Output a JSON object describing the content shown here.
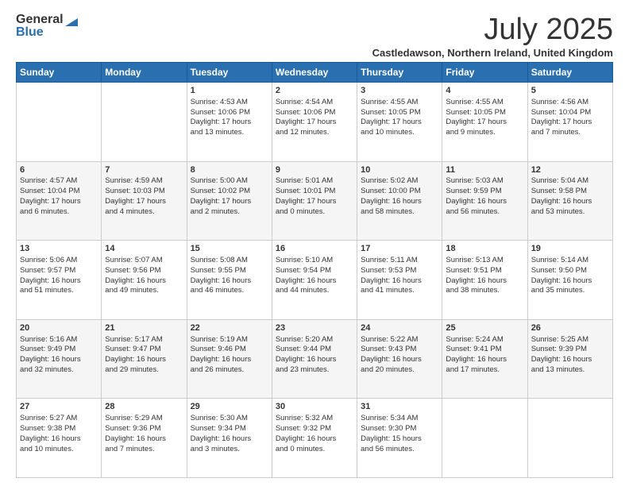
{
  "logo": {
    "general": "General",
    "blue": "Blue"
  },
  "header": {
    "title": "July 2025",
    "subtitle": "Castledawson, Northern Ireland, United Kingdom"
  },
  "weekdays": [
    "Sunday",
    "Monday",
    "Tuesday",
    "Wednesday",
    "Thursday",
    "Friday",
    "Saturday"
  ],
  "weeks": [
    {
      "days": [
        {
          "num": "",
          "sun": "",
          "mon": "",
          "detail": ""
        },
        {
          "num": "",
          "detail": ""
        },
        {
          "num": "1",
          "detail": "Sunrise: 4:53 AM\nSunset: 10:06 PM\nDaylight: 17 hours\nand 13 minutes."
        },
        {
          "num": "2",
          "detail": "Sunrise: 4:54 AM\nSunset: 10:06 PM\nDaylight: 17 hours\nand 12 minutes."
        },
        {
          "num": "3",
          "detail": "Sunrise: 4:55 AM\nSunset: 10:05 PM\nDaylight: 17 hours\nand 10 minutes."
        },
        {
          "num": "4",
          "detail": "Sunrise: 4:55 AM\nSunset: 10:05 PM\nDaylight: 17 hours\nand 9 minutes."
        },
        {
          "num": "5",
          "detail": "Sunrise: 4:56 AM\nSunset: 10:04 PM\nDaylight: 17 hours\nand 7 minutes."
        }
      ]
    },
    {
      "days": [
        {
          "num": "6",
          "detail": "Sunrise: 4:57 AM\nSunset: 10:04 PM\nDaylight: 17 hours\nand 6 minutes."
        },
        {
          "num": "7",
          "detail": "Sunrise: 4:59 AM\nSunset: 10:03 PM\nDaylight: 17 hours\nand 4 minutes."
        },
        {
          "num": "8",
          "detail": "Sunrise: 5:00 AM\nSunset: 10:02 PM\nDaylight: 17 hours\nand 2 minutes."
        },
        {
          "num": "9",
          "detail": "Sunrise: 5:01 AM\nSunset: 10:01 PM\nDaylight: 17 hours\nand 0 minutes."
        },
        {
          "num": "10",
          "detail": "Sunrise: 5:02 AM\nSunset: 10:00 PM\nDaylight: 16 hours\nand 58 minutes."
        },
        {
          "num": "11",
          "detail": "Sunrise: 5:03 AM\nSunset: 9:59 PM\nDaylight: 16 hours\nand 56 minutes."
        },
        {
          "num": "12",
          "detail": "Sunrise: 5:04 AM\nSunset: 9:58 PM\nDaylight: 16 hours\nand 53 minutes."
        }
      ]
    },
    {
      "days": [
        {
          "num": "13",
          "detail": "Sunrise: 5:06 AM\nSunset: 9:57 PM\nDaylight: 16 hours\nand 51 minutes."
        },
        {
          "num": "14",
          "detail": "Sunrise: 5:07 AM\nSunset: 9:56 PM\nDaylight: 16 hours\nand 49 minutes."
        },
        {
          "num": "15",
          "detail": "Sunrise: 5:08 AM\nSunset: 9:55 PM\nDaylight: 16 hours\nand 46 minutes."
        },
        {
          "num": "16",
          "detail": "Sunrise: 5:10 AM\nSunset: 9:54 PM\nDaylight: 16 hours\nand 44 minutes."
        },
        {
          "num": "17",
          "detail": "Sunrise: 5:11 AM\nSunset: 9:53 PM\nDaylight: 16 hours\nand 41 minutes."
        },
        {
          "num": "18",
          "detail": "Sunrise: 5:13 AM\nSunset: 9:51 PM\nDaylight: 16 hours\nand 38 minutes."
        },
        {
          "num": "19",
          "detail": "Sunrise: 5:14 AM\nSunset: 9:50 PM\nDaylight: 16 hours\nand 35 minutes."
        }
      ]
    },
    {
      "days": [
        {
          "num": "20",
          "detail": "Sunrise: 5:16 AM\nSunset: 9:49 PM\nDaylight: 16 hours\nand 32 minutes."
        },
        {
          "num": "21",
          "detail": "Sunrise: 5:17 AM\nSunset: 9:47 PM\nDaylight: 16 hours\nand 29 minutes."
        },
        {
          "num": "22",
          "detail": "Sunrise: 5:19 AM\nSunset: 9:46 PM\nDaylight: 16 hours\nand 26 minutes."
        },
        {
          "num": "23",
          "detail": "Sunrise: 5:20 AM\nSunset: 9:44 PM\nDaylight: 16 hours\nand 23 minutes."
        },
        {
          "num": "24",
          "detail": "Sunrise: 5:22 AM\nSunset: 9:43 PM\nDaylight: 16 hours\nand 20 minutes."
        },
        {
          "num": "25",
          "detail": "Sunrise: 5:24 AM\nSunset: 9:41 PM\nDaylight: 16 hours\nand 17 minutes."
        },
        {
          "num": "26",
          "detail": "Sunrise: 5:25 AM\nSunset: 9:39 PM\nDaylight: 16 hours\nand 13 minutes."
        }
      ]
    },
    {
      "days": [
        {
          "num": "27",
          "detail": "Sunrise: 5:27 AM\nSunset: 9:38 PM\nDaylight: 16 hours\nand 10 minutes."
        },
        {
          "num": "28",
          "detail": "Sunrise: 5:29 AM\nSunset: 9:36 PM\nDaylight: 16 hours\nand 7 minutes."
        },
        {
          "num": "29",
          "detail": "Sunrise: 5:30 AM\nSunset: 9:34 PM\nDaylight: 16 hours\nand 3 minutes."
        },
        {
          "num": "30",
          "detail": "Sunrise: 5:32 AM\nSunset: 9:32 PM\nDaylight: 16 hours\nand 0 minutes."
        },
        {
          "num": "31",
          "detail": "Sunrise: 5:34 AM\nSunset: 9:30 PM\nDaylight: 15 hours\nand 56 minutes."
        },
        {
          "num": "",
          "detail": ""
        },
        {
          "num": "",
          "detail": ""
        }
      ]
    }
  ]
}
